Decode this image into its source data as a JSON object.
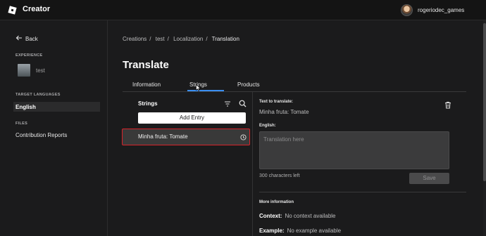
{
  "app": {
    "name": "Creator",
    "username": "rogeriodec_games"
  },
  "sidebar": {
    "back_label": "Back",
    "experience_heading": "EXPERIENCE",
    "experience_name": "test",
    "target_languages_heading": "TARGET LANGUAGES",
    "languages": [
      "English"
    ],
    "files_heading": "FILES",
    "files": [
      "Contribution Reports"
    ]
  },
  "breadcrumb": [
    "Creations",
    "test",
    "Localization",
    "Translation"
  ],
  "page_title": "Translate",
  "tabs": [
    {
      "label": "Information",
      "active": false
    },
    {
      "label": "Strings",
      "active": true
    },
    {
      "label": "Products",
      "active": false
    }
  ],
  "strings_panel": {
    "title": "Strings",
    "add_entry_label": "Add Entry",
    "entries": [
      {
        "label": "Minha fruta: Tomate",
        "selected": true
      }
    ]
  },
  "detail": {
    "text_to_translate_label": "Text to translate:",
    "text_to_translate": "Minha fruta: Tomate",
    "english_label": "English:",
    "translation_placeholder": "Translation here",
    "chars_left": "300 characters left",
    "save_label": "Save",
    "more_info_label": "More information",
    "context_label": "Context:",
    "context_value": "No context available",
    "example_label": "Example:",
    "example_value": "No example available"
  },
  "colors": {
    "accent": "#3b8ef0",
    "highlight": "#d8232a",
    "background": "#1b1b1c"
  }
}
